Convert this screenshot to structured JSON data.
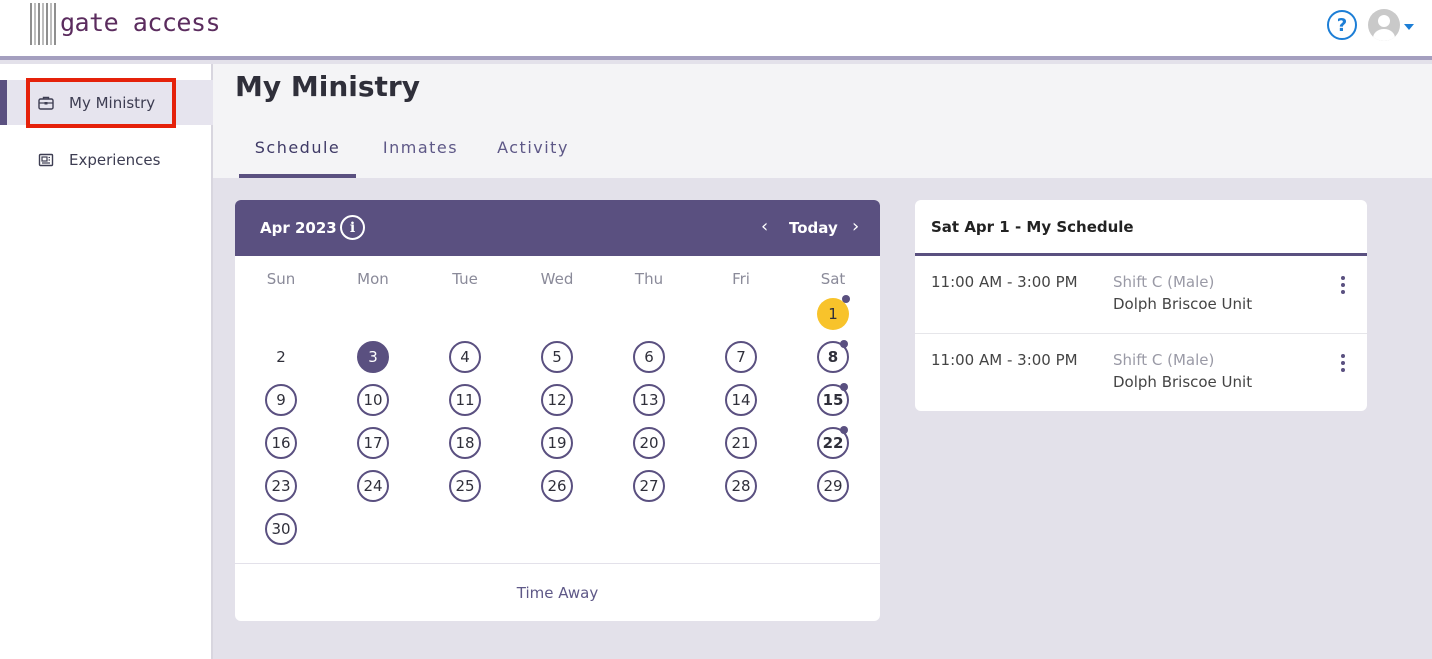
{
  "header": {
    "logo_text": "gate access",
    "help_icon": "question-circle-icon",
    "user_icon": "user-avatar-icon"
  },
  "sidebar": {
    "items": [
      {
        "label": "My Ministry",
        "icon": "briefcase-icon"
      },
      {
        "label": "Experiences",
        "icon": "newspaper-icon"
      }
    ]
  },
  "main": {
    "title": "My Ministry",
    "tabs": [
      {
        "label": "Schedule"
      },
      {
        "label": "Inmates"
      },
      {
        "label": "Activity"
      }
    ]
  },
  "calendar": {
    "month_label": "Apr 2023",
    "info_glyph": "i",
    "prev_glyph": "‹",
    "today_label": "Today",
    "next_glyph": "›",
    "weekdays": [
      "Sun",
      "Mon",
      "Tue",
      "Wed",
      "Thu",
      "Fri",
      "Sat"
    ],
    "days": [
      "1",
      "2",
      "3",
      "4",
      "5",
      "6",
      "7",
      "8",
      "9",
      "10",
      "11",
      "12",
      "13",
      "14",
      "15",
      "16",
      "17",
      "18",
      "19",
      "20",
      "21",
      "22",
      "23",
      "24",
      "25",
      "26",
      "27",
      "28",
      "29",
      "30"
    ],
    "time_away_label": "Time Away"
  },
  "schedule": {
    "title": "Sat Apr 1 - My Schedule",
    "rows": [
      {
        "time": "11:00 AM - 3:00 PM",
        "shift": "Shift C (Male)",
        "unit": "Dolph Briscoe Unit"
      },
      {
        "time": "11:00 AM - 3:00 PM",
        "shift": "Shift C (Male)",
        "unit": "Dolph Briscoe Unit"
      }
    ]
  },
  "colors": {
    "primary": "#5a5080",
    "accent_today": "#f8c32b",
    "help_blue": "#1c7ed6",
    "highlight_red": "#e5210a"
  }
}
